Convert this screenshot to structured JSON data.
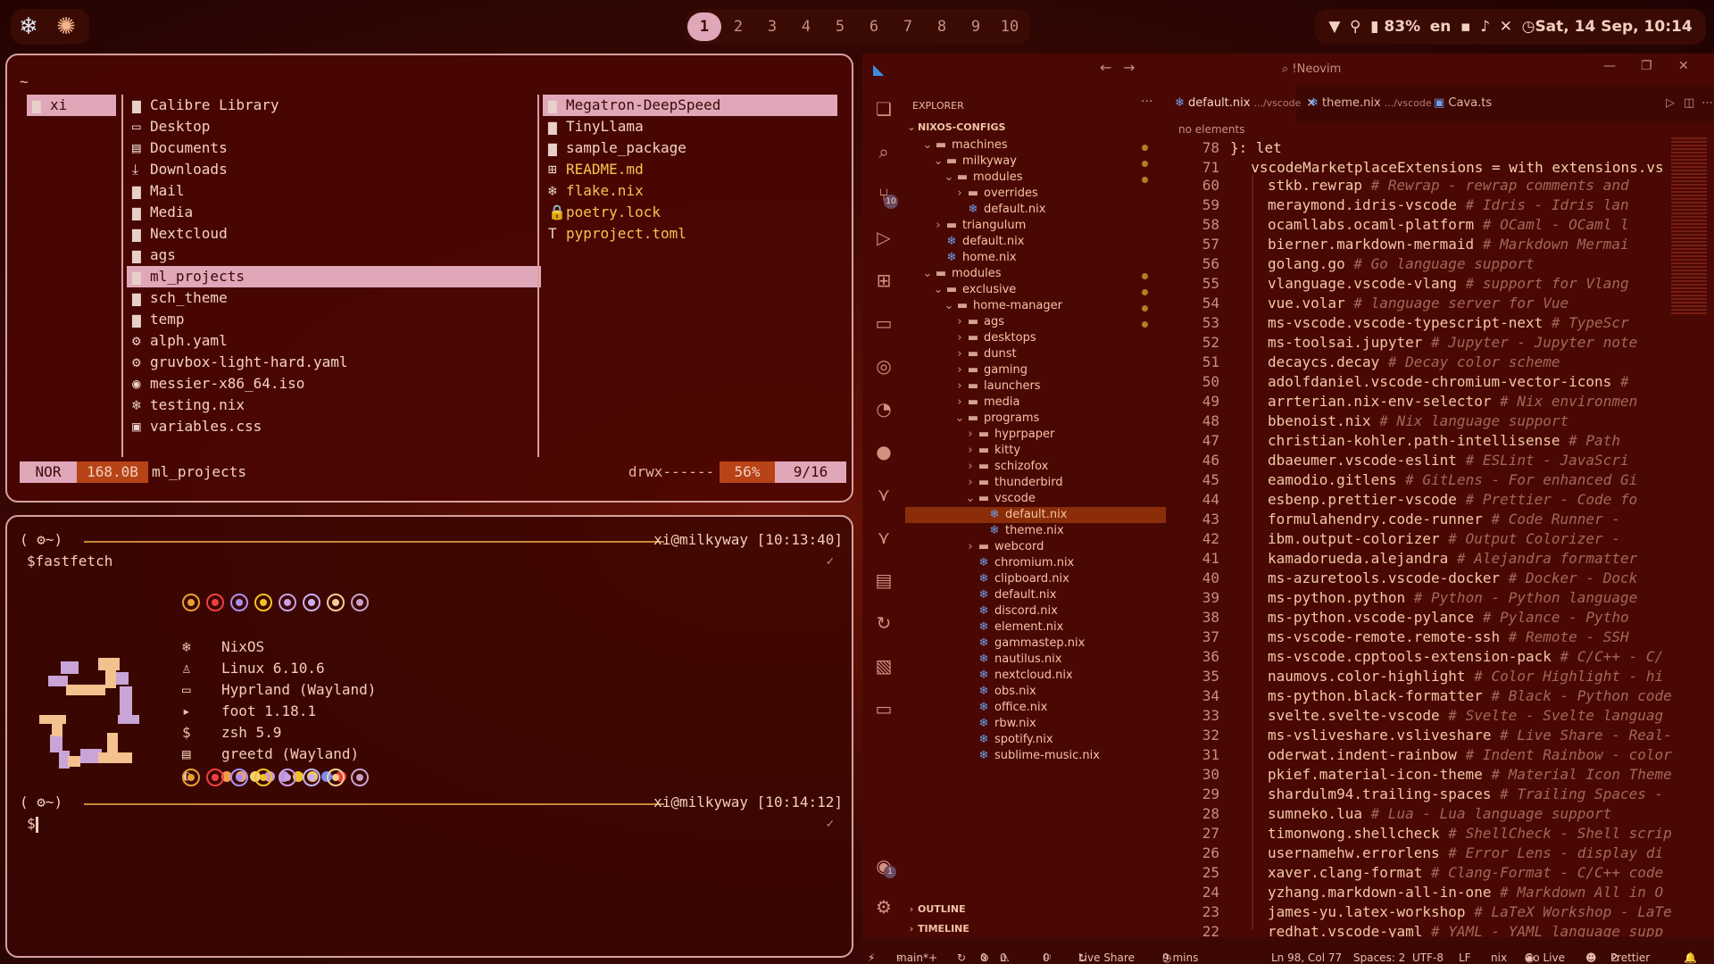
{
  "topbar": {
    "left_icons": [
      "nixos-snowflake-icon",
      "openai-icon"
    ],
    "workspaces": [
      "1",
      "2",
      "3",
      "4",
      "5",
      "6",
      "7",
      "8",
      "9",
      "10"
    ],
    "active_workspace": "1",
    "battery": "83%",
    "lang": "en",
    "clock": "Sat, 14 Sep, 10:14"
  },
  "yazi": {
    "path": "~",
    "parent": [
      {
        "name": "xi",
        "icon": "folder"
      }
    ],
    "current": [
      {
        "name": "Calibre Library",
        "icon": "folder"
      },
      {
        "name": "Desktop",
        "icon": "desktop"
      },
      {
        "name": "Documents",
        "icon": "document"
      },
      {
        "name": "Downloads",
        "icon": "download"
      },
      {
        "name": "Mail",
        "icon": "folder"
      },
      {
        "name": "Media",
        "icon": "folder"
      },
      {
        "name": "Nextcloud",
        "icon": "folder"
      },
      {
        "name": "ags",
        "icon": "folder"
      },
      {
        "name": "ml_projects",
        "icon": "folder"
      },
      {
        "name": "sch_theme",
        "icon": "folder"
      },
      {
        "name": "temp",
        "icon": "folder"
      },
      {
        "name": "alph.yaml",
        "icon": "gear"
      },
      {
        "name": "gruvbox-light-hard.yaml",
        "icon": "gear"
      },
      {
        "name": "messier-x86_64.iso",
        "icon": "disc"
      },
      {
        "name": "testing.nix",
        "icon": "nix"
      },
      {
        "name": "variables.css",
        "icon": "css"
      }
    ],
    "preview": [
      {
        "name": "Megatron-DeepSpeed",
        "icon": "folder"
      },
      {
        "name": "TinyLlama",
        "icon": "folder"
      },
      {
        "name": "sample_package",
        "icon": "folder"
      },
      {
        "name": "README.md",
        "icon": "markdown"
      },
      {
        "name": "flake.nix",
        "icon": "nix"
      },
      {
        "name": "poetry.lock",
        "icon": "lock"
      },
      {
        "name": "pyproject.toml",
        "icon": "toml"
      }
    ],
    "status": {
      "mode": "NOR",
      "size": "168.0B",
      "name": "ml_projects",
      "perms": "drwx------",
      "percent": "56%",
      "position": "9/16"
    }
  },
  "foot": {
    "prompt1": {
      "left": "( ⚙~)",
      "right": "xi@milkyway [10:13:40]"
    },
    "command": "$fastfetch",
    "info": [
      {
        "icon": "nixos-icon",
        "value": "NixOS"
      },
      {
        "icon": "linux-icon",
        "value": "Linux 6.10.6"
      },
      {
        "icon": "window-icon",
        "value": "Hyprland (Wayland)"
      },
      {
        "icon": "terminal-icon",
        "value": "foot 1.18.1"
      },
      {
        "icon": "shell-icon",
        "value": "zsh 5.9"
      },
      {
        "icon": "display-manager-icon",
        "value": "greetd (Wayland)"
      }
    ],
    "palette": [
      "#f59a4a",
      "#e8a07a",
      "#f4d07a",
      "#c79ad8",
      "#b995e0",
      "#f4c220",
      "#f2c75a",
      "#7a8df2",
      "#ef3b3b"
    ],
    "ring_colors": [
      "#e8a030",
      "#ef4040",
      "#a890f0",
      "#f4c220",
      "#c8a0e0",
      "#c8b0f0",
      "#f4d090",
      "#c8a0c8"
    ],
    "prompt2": {
      "left": "( ⚙~)",
      "right": "xi@milkyway [10:14:12]"
    },
    "command2": "$"
  },
  "vscode": {
    "title": "!Neovim",
    "explorer_label": "EXPLORER",
    "section": "NIXOS-CONFIGS",
    "tree": [
      {
        "label": "machines",
        "depth": 1,
        "type": "folder-open",
        "dot": true
      },
      {
        "label": "milkyway",
        "depth": 2,
        "type": "folder-open",
        "dot": true
      },
      {
        "label": "modules",
        "depth": 3,
        "type": "folder-open-nix",
        "dot": true
      },
      {
        "label": "overrides",
        "depth": 4,
        "type": "folder"
      },
      {
        "label": "default.nix",
        "depth": 4,
        "type": "nix"
      },
      {
        "label": "triangulum",
        "depth": 2,
        "type": "folder"
      },
      {
        "label": "default.nix",
        "depth": 2,
        "type": "nix"
      },
      {
        "label": "home.nix",
        "depth": 2,
        "type": "nix"
      },
      {
        "label": "modules",
        "depth": 1,
        "type": "folder-open-nix",
        "dot": true
      },
      {
        "label": "exclusive",
        "depth": 2,
        "type": "folder-open",
        "dot": true
      },
      {
        "label": "home-manager",
        "depth": 3,
        "type": "folder-open",
        "dot": true
      },
      {
        "label": "ags",
        "depth": 4,
        "type": "folder",
        "dot": true
      },
      {
        "label": "desktops",
        "depth": 4,
        "type": "folder"
      },
      {
        "label": "dunst",
        "depth": 4,
        "type": "folder"
      },
      {
        "label": "gaming",
        "depth": 4,
        "type": "folder"
      },
      {
        "label": "launchers",
        "depth": 4,
        "type": "folder"
      },
      {
        "label": "media",
        "depth": 4,
        "type": "folder"
      },
      {
        "label": "programs",
        "depth": 4,
        "type": "folder-open"
      },
      {
        "label": "hyprpaper",
        "depth": 5,
        "type": "folder"
      },
      {
        "label": "kitty",
        "depth": 5,
        "type": "folder"
      },
      {
        "label": "schizofox",
        "depth": 5,
        "type": "folder"
      },
      {
        "label": "thunderbird",
        "depth": 5,
        "type": "folder"
      },
      {
        "label": "vscode",
        "depth": 5,
        "type": "folder-open-vscode"
      },
      {
        "label": "default.nix",
        "depth": 6,
        "type": "nix",
        "selected": true
      },
      {
        "label": "theme.nix",
        "depth": 6,
        "type": "nix"
      },
      {
        "label": "webcord",
        "depth": 5,
        "type": "folder"
      },
      {
        "label": "chromium.nix",
        "depth": 5,
        "type": "nix"
      },
      {
        "label": "clipboard.nix",
        "depth": 5,
        "type": "nix"
      },
      {
        "label": "default.nix",
        "depth": 5,
        "type": "nix"
      },
      {
        "label": "discord.nix",
        "depth": 5,
        "type": "nix"
      },
      {
        "label": "element.nix",
        "depth": 5,
        "type": "nix"
      },
      {
        "label": "gammastep.nix",
        "depth": 5,
        "type": "nix"
      },
      {
        "label": "nautilus.nix",
        "depth": 5,
        "type": "nix"
      },
      {
        "label": "nextcloud.nix",
        "depth": 5,
        "type": "nix"
      },
      {
        "label": "obs.nix",
        "depth": 5,
        "type": "nix"
      },
      {
        "label": "office.nix",
        "depth": 5,
        "type": "nix"
      },
      {
        "label": "rbw.nix",
        "depth": 5,
        "type": "nix"
      },
      {
        "label": "spotify.nix",
        "depth": 5,
        "type": "nix"
      },
      {
        "label": "sublime-music.nix",
        "depth": 5,
        "type": "nix"
      }
    ],
    "outline": "OUTLINE",
    "timeline": "TIMELINE",
    "tabs": [
      {
        "name": "default.nix",
        "path": ".../vscode",
        "close": "×"
      },
      {
        "name": "theme.nix",
        "path": ".../vscode"
      },
      {
        "name": "Cava.ts",
        "path": ""
      }
    ],
    "breadcrumb": "no elements",
    "sticky": [
      {
        "ln": "78",
        "text": "}: let"
      },
      {
        "ln": "71",
        "text": "  vscodeMarketplaceExtensions = with extensions.vs"
      }
    ],
    "code": [
      {
        "ln": "60",
        "ext": "stkb.rewrap",
        "c": "# Rewrap - rewrap comments and"
      },
      {
        "ln": "59",
        "ext": "meraymond.idris-vscode",
        "c": "# Idris - Idris lan"
      },
      {
        "ln": "58",
        "ext": "ocamllabs.ocaml-platform",
        "c": "# OCaml - OCaml l"
      },
      {
        "ln": "57",
        "ext": "bierner.markdown-mermaid",
        "c": "# Markdown Mermai"
      },
      {
        "ln": "56",
        "ext": "golang.go",
        "c": "# Go language support"
      },
      {
        "ln": "55",
        "ext": "vlanguage.vscode-vlang",
        "c": "# support for Vlang"
      },
      {
        "ln": "54",
        "ext": "vue.volar",
        "c": "# language server for Vue"
      },
      {
        "ln": "53",
        "ext": "ms-vscode.vscode-typescript-next",
        "c": "# TypeScr"
      },
      {
        "ln": "52",
        "ext": "ms-toolsai.jupyter",
        "c": "# Jupyter - Jupyter note"
      },
      {
        "ln": "51",
        "ext": "decaycs.decay",
        "c": "# Decay color scheme"
      },
      {
        "ln": "50",
        "ext": "adolfdaniel.vscode-chromium-vector-icons",
        "c": "#"
      },
      {
        "ln": "49",
        "ext": "arrterian.nix-env-selector",
        "c": "# Nix environmen"
      },
      {
        "ln": "48",
        "ext": "bbenoist.nix",
        "c": "# Nix language support"
      },
      {
        "ln": "47",
        "ext": "christian-kohler.path-intellisense",
        "c": "# Path"
      },
      {
        "ln": "46",
        "ext": "dbaeumer.vscode-eslint",
        "c": "# ESLint - JavaScri"
      },
      {
        "ln": "45",
        "ext": "eamodio.gitlens",
        "c": "# GitLens - For enhanced Gi"
      },
      {
        "ln": "44",
        "ext": "esbenp.prettier-vscode",
        "c": "# Prettier - Code fo"
      },
      {
        "ln": "43",
        "ext": "formulahendry.code-runner",
        "c": "# Code Runner -"
      },
      {
        "ln": "42",
        "ext": "ibm.output-colorizer",
        "c": "# Output Colorizer -"
      },
      {
        "ln": "41",
        "ext": "kamadorueda.alejandra",
        "c": "# Alejandra formatter"
      },
      {
        "ln": "40",
        "ext": "ms-azuretools.vscode-docker",
        "c": "# Docker - Dock"
      },
      {
        "ln": "39",
        "ext": "ms-python.python",
        "c": "# Python - Python language"
      },
      {
        "ln": "38",
        "ext": "ms-python.vscode-pylance",
        "c": "# Pylance - Pytho"
      },
      {
        "ln": "37",
        "ext": "ms-vscode-remote.remote-ssh",
        "c": "# Remote - SSH"
      },
      {
        "ln": "36",
        "ext": "ms-vscode.cpptools-extension-pack",
        "c": "# C/C++ - C/"
      },
      {
        "ln": "35",
        "ext": "naumovs.color-highlight",
        "c": "# Color Highlight - hi"
      },
      {
        "ln": "34",
        "ext": "ms-python.black-formatter",
        "c": "# Black - Python code"
      },
      {
        "ln": "33",
        "ext": "svelte.svelte-vscode",
        "c": "# Svelte - Svelte languag"
      },
      {
        "ln": "32",
        "ext": "ms-vsliveshare.vsliveshare",
        "c": "# Live Share - Real-"
      },
      {
        "ln": "31",
        "ext": "oderwat.indent-rainbow",
        "c": "# Indent Rainbow - color"
      },
      {
        "ln": "30",
        "ext": "pkief.material-icon-theme",
        "c": "# Material Icon Theme"
      },
      {
        "ln": "29",
        "ext": "shardulm94.trailing-spaces",
        "c": "# Trailing Spaces -"
      },
      {
        "ln": "28",
        "ext": "sumneko.lua",
        "c": "# Lua - Lua language support"
      },
      {
        "ln": "27",
        "ext": "timonwong.shellcheck",
        "c": "# ShellCheck - Shell scrip"
      },
      {
        "ln": "26",
        "ext": "usernamehw.errorlens",
        "c": "# Error Lens - display di"
      },
      {
        "ln": "25",
        "ext": "xaver.clang-format",
        "c": "# Clang-Format - C/C++ code"
      },
      {
        "ln": "24",
        "ext": "yzhang.markdown-all-in-one",
        "c": "# Markdown All in O"
      },
      {
        "ln": "23",
        "ext": "james-yu.latex-workshop",
        "c": "# LaTeX Workshop - LaTe"
      },
      {
        "ln": "22",
        "ext": "redhat.vscode-yaml",
        "c": "# YAML - YAML language supp"
      }
    ],
    "status": {
      "branch": "main*+",
      "errors": "0",
      "warnings": "0",
      "ports": "0",
      "liveshare": "Live Share",
      "time": "9 mins",
      "position": "Ln 98, Col 77",
      "spaces": "Spaces: 2",
      "encoding": "UTF-8",
      "eol": "LF",
      "language": "nix",
      "golive": "Go Live",
      "prettier": "Prettier"
    },
    "scm_badge": "10",
    "account_badge": "1"
  }
}
